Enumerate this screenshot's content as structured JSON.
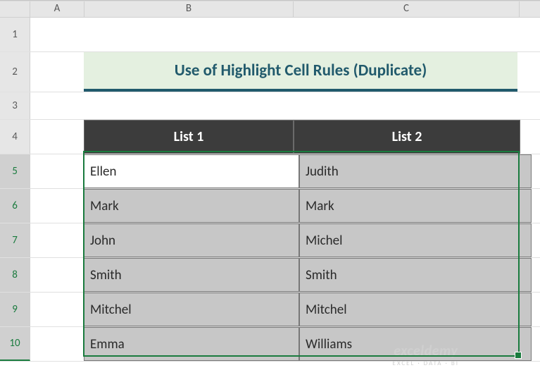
{
  "columns": {
    "A": "A",
    "B": "B",
    "C": "C"
  },
  "rows": {
    "r1": "1",
    "r2": "2",
    "r3": "3",
    "r4": "4",
    "r5": "5",
    "r6": "6",
    "r7": "7",
    "r8": "8",
    "r9": "9",
    "r10": "10"
  },
  "title": "Use of Highlight Cell Rules (Duplicate)",
  "headers": {
    "list1": "List 1",
    "list2": "List 2"
  },
  "data": [
    {
      "list1": "Ellen",
      "list2": "Judith"
    },
    {
      "list1": "Mark",
      "list2": "Mark"
    },
    {
      "list1": "John",
      "list2": "Michel"
    },
    {
      "list1": "Smith",
      "list2": "Smith"
    },
    {
      "list1": "Mitchel",
      "list2": "Mitchel"
    },
    {
      "list1": "Emma",
      "list2": "Williams"
    }
  ],
  "watermark": {
    "top": "exceldemy",
    "bot": "EXCEL · DATA · BI"
  },
  "chart_data": {
    "type": "table",
    "title": "Use of Highlight Cell Rules (Duplicate)",
    "columns": [
      "List 1",
      "List 2"
    ],
    "rows": [
      [
        "Ellen",
        "Judith"
      ],
      [
        "Mark",
        "Mark"
      ],
      [
        "John",
        "Michel"
      ],
      [
        "Smith",
        "Smith"
      ],
      [
        "Mitchel",
        "Mitchel"
      ],
      [
        "Emma",
        "Williams"
      ]
    ],
    "selection": "B5:C10",
    "active_cell": "B5"
  }
}
